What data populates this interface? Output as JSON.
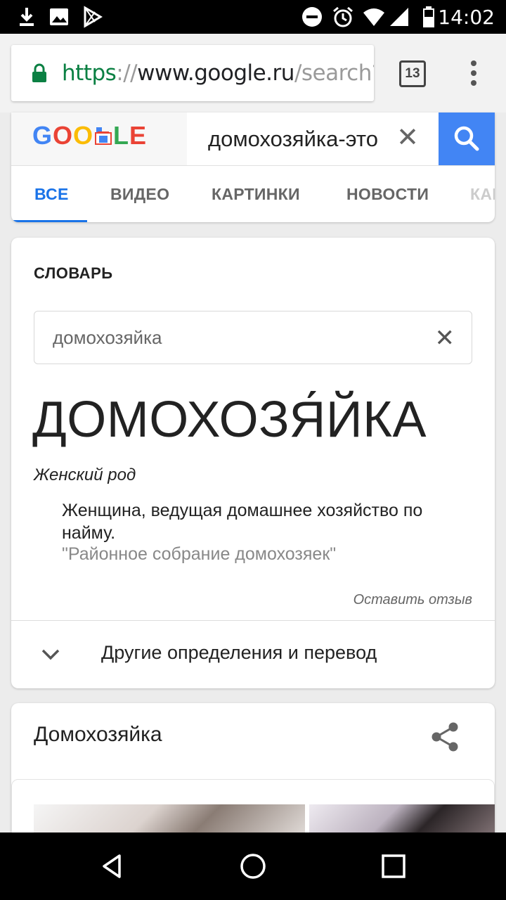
{
  "status_bar": {
    "time": "14:02",
    "left_icons": [
      "download-icon",
      "image-icon",
      "play-store-icon"
    ],
    "right_icons": [
      "dnd-icon",
      "alarm-icon",
      "wifi-icon",
      "signal-icon",
      "battery-icon"
    ]
  },
  "browser": {
    "url_scheme": "https",
    "url_sep": "://",
    "url_host": "www.google.ru",
    "url_path": "/search?",
    "tab_count": "13"
  },
  "google": {
    "logo_letters": [
      "G",
      "O",
      "O",
      "",
      "L",
      "E"
    ],
    "query": "домохозяйка-это",
    "tabs": [
      {
        "label": "ВСЕ",
        "active": true
      },
      {
        "label": "ВИДЕО",
        "active": false
      },
      {
        "label": "КАРТИНКИ",
        "active": false
      },
      {
        "label": "НОВОСТИ",
        "active": false
      },
      {
        "label": "КАРТЫ",
        "active": false
      }
    ]
  },
  "dictionary": {
    "heading": "СЛОВАРЬ",
    "search_value": "домохозяйка",
    "headword": "ДОМОХОЗЯ́ЙКА",
    "gender": "Женский род",
    "definition": "Женщина, ведущая домашнее хозяйство по найму.",
    "example": "\"Районное собрание домохозяек\"",
    "feedback": "Оставить отзыв",
    "more": "Другие определения и перевод"
  },
  "knowledge": {
    "title": "Домохозяйка"
  },
  "colors": {
    "accent": "#1a73e8",
    "search_button": "#4285f4",
    "secure_green": "#0b8043"
  }
}
